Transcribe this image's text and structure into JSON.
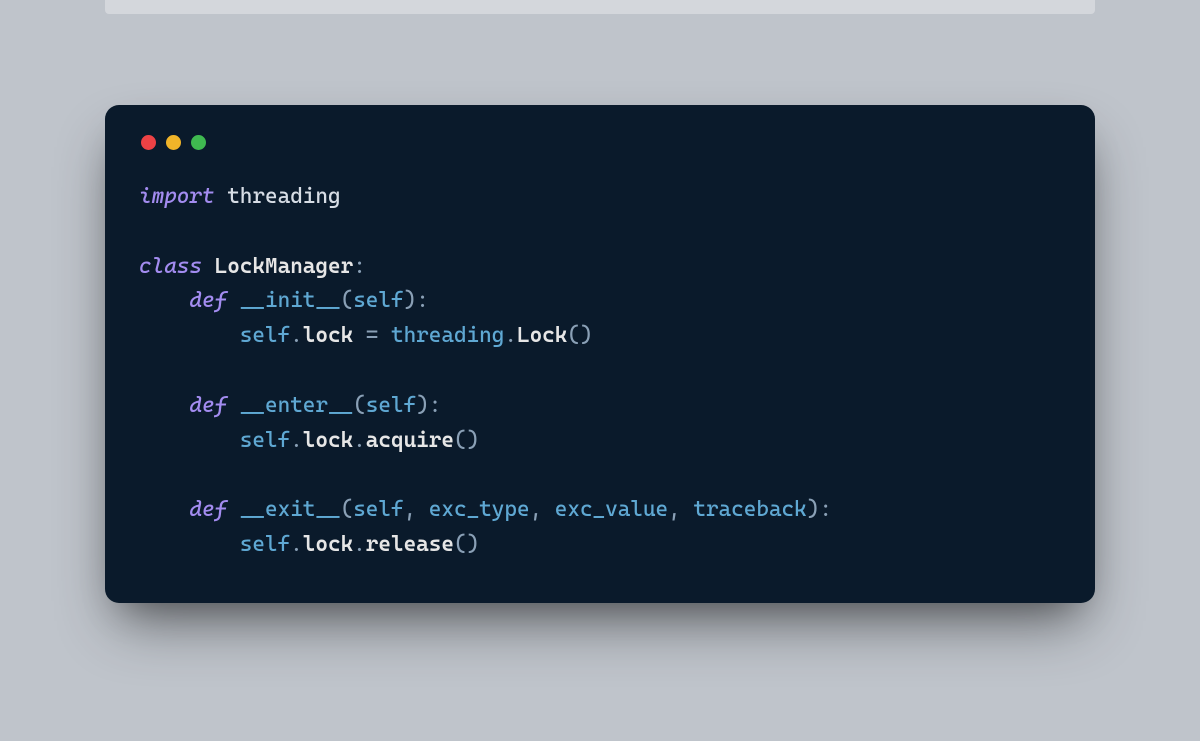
{
  "traffic_lights": {
    "red": "#ed4245",
    "yellow": "#f0b429",
    "green": "#3fb950"
  },
  "code": {
    "l1": {
      "kw": "import",
      "mod": "threading"
    },
    "l3": {
      "kw": "class",
      "name": "LockManager",
      "colon": ":"
    },
    "l4": {
      "kw": "def",
      "func": "__init__",
      "lp": "(",
      "self": "self",
      "rp": ")",
      "colon": ":"
    },
    "l5": {
      "self": "self",
      "dot1": ".",
      "attr": "lock",
      "eq": " = ",
      "mod": "threading",
      "dot2": ".",
      "call": "Lock",
      "lp": "(",
      "rp": ")"
    },
    "l7": {
      "kw": "def",
      "func": "__enter__",
      "lp": "(",
      "self": "self",
      "rp": ")",
      "colon": ":"
    },
    "l8": {
      "self": "self",
      "dot1": ".",
      "attr": "lock",
      "dot2": ".",
      "call": "acquire",
      "lp": "(",
      "rp": ")"
    },
    "l10": {
      "kw": "def",
      "func": "__exit__",
      "lp": "(",
      "self": "self",
      "c1": ", ",
      "a1": "exc_type",
      "c2": ", ",
      "a2": "exc_value",
      "c3": ", ",
      "a3": "traceback",
      "rp": ")",
      "colon": ":"
    },
    "l11": {
      "self": "self",
      "dot1": ".",
      "attr": "lock",
      "dot2": ".",
      "call": "release",
      "lp": "(",
      "rp": ")"
    }
  }
}
